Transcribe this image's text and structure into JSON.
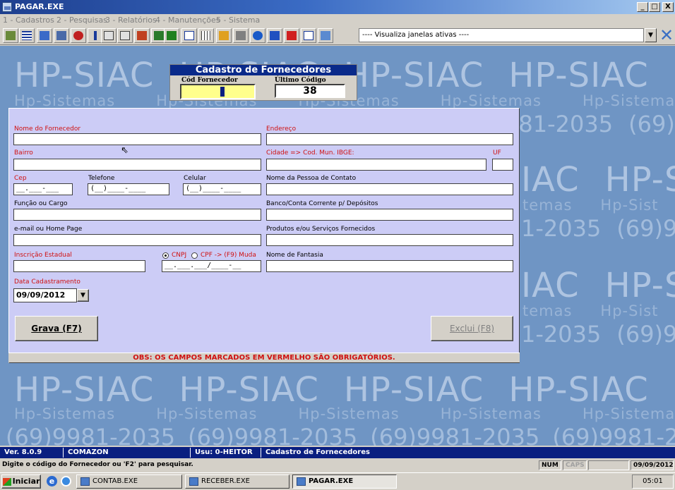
{
  "window": {
    "title": "PAGAR.EXE",
    "controls": [
      "_",
      "□",
      "X"
    ]
  },
  "menu": [
    "1 - Cadastros",
    "2 - Pesquisas",
    "3 - Relatórios",
    "4 - Manutenções",
    "5 - Sistema"
  ],
  "toolbar": {
    "window_select": "---- Visualiza janelas ativas ----"
  },
  "watermark": {
    "big": "HP-SIAC",
    "mid": "Hp-Sistemas",
    "phone": "(69)9981-2035"
  },
  "header": {
    "title": "Cadastro de Fornecedores",
    "code_label": "Cód Fornecedor",
    "last_code_label": "Último Código",
    "last_code_value": "38"
  },
  "form": {
    "name_label": "Nome do Fornecedor",
    "address_label": "Endereço",
    "district_label": "Bairro",
    "city_label": "Cidade => Cod. Mun. IBGE:",
    "uf_label": "UF",
    "cep_label": "Cep",
    "cep_mask": "__.___-___",
    "phone_label": "Telefone",
    "phone_mask": "(__)____-____",
    "mobile_label": "Celular",
    "mobile_mask": "(__)____-____",
    "contact_label": "Nome da Pessoa de Contato",
    "role_label": "Função ou Cargo",
    "bank_label": "Banco/Conta Corrente p/ Depósitos",
    "email_label": "e-mail ou Home Page",
    "products_label": "Produtos e/ou Serviços Fornecidos",
    "ie_label": "Inscrição Estadual",
    "cnpj_label": "CNPJ",
    "cpf_label": "CPF -> (F9) Muda",
    "cnpj_mask": "__.___.___/____-__",
    "trade_name_label": "Nome de Fantasia",
    "date_label": "Data Cadastramento",
    "date_value": "09/09/2012",
    "save_label": "Grava (F7)",
    "delete_label": "Exclui (F8)",
    "obs": "OBS: OS CAMPOS MARCADOS EM VERMELHO SÃO OBRIGATÓRIOS."
  },
  "status1": {
    "version": "Ver. 8.0.9",
    "company": "COMAZON",
    "user": "Usu: 0-HEITOR",
    "screen": "Cadastro de Fornecedores"
  },
  "status2": {
    "hint": "Digite o código do Fornecedor ou 'F2' para pesquisar.",
    "num": "NUM",
    "caps": "CAPS",
    "date": "09/09/2012"
  },
  "taskbar": {
    "start": "Iniciar",
    "tasks": [
      "CONTAB.EXE",
      "RECEBER.EXE",
      "PAGAR.EXE"
    ],
    "clock": "05:01"
  }
}
